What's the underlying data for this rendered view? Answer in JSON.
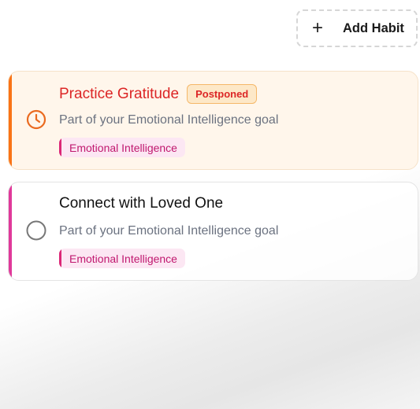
{
  "toolbar": {
    "add_label": "Add Habit",
    "add_icon": "plus-icon"
  },
  "habits": [
    {
      "title": "Practice Gratitude",
      "badge": "Postponed",
      "subtitle": "Part of your Emotional Intelligence goal",
      "tag": "Emotional Intelligence",
      "status_icon": "clock-icon",
      "accent": "#f97316"
    },
    {
      "title": "Connect with Loved One",
      "subtitle": "Part of your Emotional Intelligence goal",
      "tag": "Emotional Intelligence",
      "status_icon": "empty-circle-icon",
      "accent": "#e0399a"
    }
  ]
}
